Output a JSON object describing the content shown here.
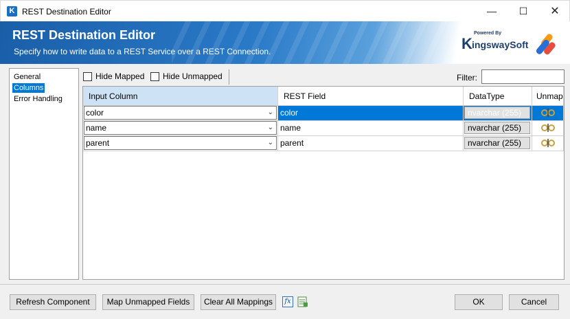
{
  "window": {
    "title": "REST Destination Editor",
    "app_icon": "K",
    "minimize_glyph": "—",
    "maximize_glyph": "☐",
    "close_glyph": "✕"
  },
  "banner": {
    "title": "REST Destination Editor",
    "subtitle": "Specify how to write data to a REST Service over a REST Connection.",
    "logo_powered": "Powered By",
    "logo_k": "K",
    "logo_rest": "ingswaySoft"
  },
  "nav": {
    "items": [
      {
        "label": "General",
        "selected": false
      },
      {
        "label": "Columns",
        "selected": true
      },
      {
        "label": "Error Handling",
        "selected": false
      }
    ]
  },
  "toolbar": {
    "hide_mapped": "Hide Mapped",
    "hide_unmapped": "Hide Unmapped",
    "filter_label": "Filter:",
    "filter_value": ""
  },
  "grid": {
    "headers": {
      "input_column": "Input Column",
      "rest_field": "REST Field",
      "datatype": "DataType",
      "unmap": "Unmap"
    },
    "rows": [
      {
        "input": "color",
        "field": "color",
        "datatype": "nvarchar (255)",
        "selected": true
      },
      {
        "input": "name",
        "field": "name",
        "datatype": "nvarchar (255)",
        "selected": false
      },
      {
        "input": "parent",
        "field": "parent",
        "datatype": "nvarchar (255)",
        "selected": false
      }
    ]
  },
  "footer": {
    "refresh": "Refresh Component",
    "map_unmapped": "Map Unmapped Fields",
    "clear_all": "Clear All Mappings",
    "fx_icon": "fx",
    "ok": "OK",
    "cancel": "Cancel"
  },
  "colors": {
    "accent": "#0078d7",
    "banner": "#1a5ea8"
  }
}
